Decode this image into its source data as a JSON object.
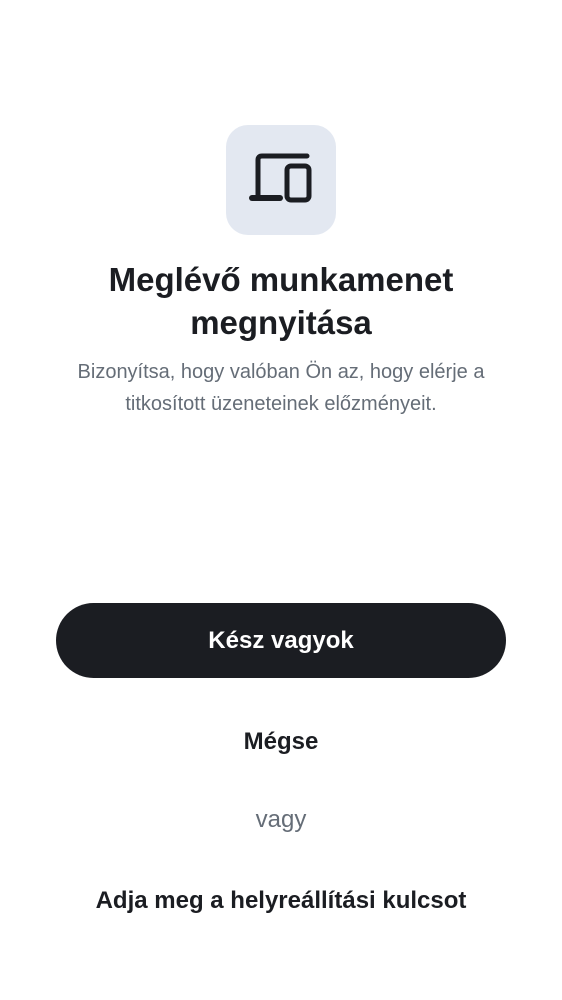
{
  "header": {
    "icon": "devices-icon",
    "icon_bg": "#e3e8f1",
    "title": "Meglévő munkamenet megnyitása",
    "subtitle": "Bizonyítsa, hogy valóban Ön az, hogy elérje a titkosított üzeneteinek előzményeit."
  },
  "actions": {
    "primary_label": "Kész vagyok",
    "primary_color": "#1b1d22",
    "cancel_label": "Mégse",
    "separator_text": "vagy",
    "recovery_label": "Adja meg a helyreállítási kulcsot"
  }
}
